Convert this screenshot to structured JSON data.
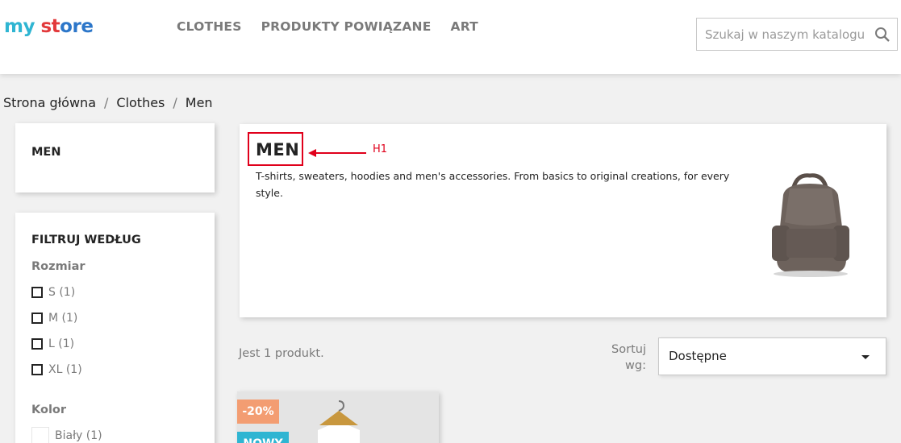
{
  "header": {
    "logo": {
      "part1": "my",
      "part2": " ",
      "part3": "st",
      "part4": "ore"
    },
    "nav": [
      "CLOTHES",
      "PRODUKTY POWIĄZANE",
      "ART"
    ],
    "search_placeholder": "Szukaj w naszym katalogu"
  },
  "breadcrumb": [
    "Strona główna",
    "Clothes",
    "Men"
  ],
  "sidebar": {
    "category_title": "MEN",
    "filter_title": "FILTRUJ WEDŁUG",
    "size_label": "Rozmiar",
    "sizes": [
      "S (1)",
      "M (1)",
      "L (1)",
      "XL (1)"
    ],
    "color_label": "Kolor",
    "colors": [
      "Biały (1)"
    ]
  },
  "category": {
    "title": "MEN",
    "annotation": "H1",
    "description": "T-shirts, sweaters, hoodies and men's accessories. From basics to original creations, for every style."
  },
  "listing": {
    "count_text": "Jest 1 produkt.",
    "sort_label": "Sortuj wg:",
    "sort_value": "Dostępne"
  },
  "product": {
    "discount_badge": "-20%",
    "new_badge": "NOWY"
  },
  "colors": {
    "accent_blue": "#2fb5d2",
    "annotation_red": "#e0001b",
    "discount_orange": "#f39d72"
  }
}
